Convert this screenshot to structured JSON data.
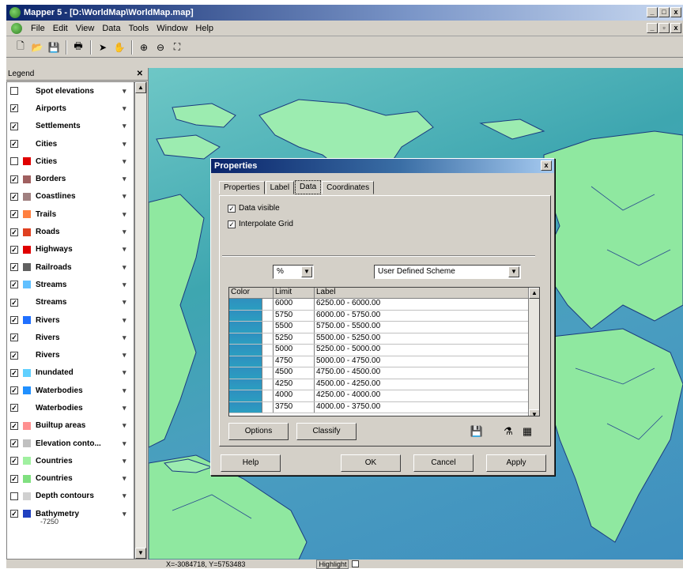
{
  "window": {
    "title": "Mapper 5 - [D:\\WorldMap\\WorldMap.map]"
  },
  "menu": [
    "File",
    "Edit",
    "View",
    "Data",
    "Tools",
    "Window",
    "Help"
  ],
  "legend": {
    "title": "Legend",
    "items": [
      {
        "label": "Spot elevations",
        "checked": false,
        "swatch": ""
      },
      {
        "label": "Airports",
        "checked": true,
        "swatch": ""
      },
      {
        "label": "Settlements",
        "checked": true,
        "swatch": ""
      },
      {
        "label": "Cities",
        "checked": true,
        "swatch": ""
      },
      {
        "label": "Cities",
        "checked": false,
        "swatch": "#e00000"
      },
      {
        "label": "Borders",
        "checked": true,
        "swatch": "#a06060"
      },
      {
        "label": "Coastlines",
        "checked": true,
        "swatch": "#a08080"
      },
      {
        "label": "Trails",
        "checked": true,
        "swatch": "#ff8040"
      },
      {
        "label": "Roads",
        "checked": true,
        "swatch": "#e04020"
      },
      {
        "label": "Highways",
        "checked": true,
        "swatch": "#e00000"
      },
      {
        "label": "Railroads",
        "checked": true,
        "swatch": "#606060"
      },
      {
        "label": "Streams",
        "checked": true,
        "swatch": "#60c0ff"
      },
      {
        "label": "Streams",
        "checked": true,
        "swatch": ""
      },
      {
        "label": "Rivers",
        "checked": true,
        "swatch": "#2070ff"
      },
      {
        "label": "Rivers",
        "checked": true,
        "swatch": ""
      },
      {
        "label": "Rivers",
        "checked": true,
        "swatch": ""
      },
      {
        "label": "Inundated",
        "checked": true,
        "swatch": "#60d0ff"
      },
      {
        "label": "Waterbodies",
        "checked": true,
        "swatch": "#2090ff"
      },
      {
        "label": "Waterbodies",
        "checked": true,
        "swatch": ""
      },
      {
        "label": "Builtup areas",
        "checked": true,
        "swatch": "#ff9090"
      },
      {
        "label": "Elevation conto...",
        "checked": true,
        "swatch": "#c0c0c0"
      },
      {
        "label": "Countries",
        "checked": true,
        "swatch": "#a0f0a0"
      },
      {
        "label": "Countries",
        "checked": true,
        "swatch": "#80e080"
      },
      {
        "label": "Depth contours",
        "checked": false,
        "swatch": "#d0d0d0"
      },
      {
        "label": "Bathymetry",
        "checked": true,
        "swatch": "#2040c0"
      }
    ],
    "bathymetry_sub": "-7250"
  },
  "status": {
    "coords": "X=-3084718, Y=5753483",
    "highlight": "Highlight"
  },
  "dialog": {
    "title": "Properties",
    "tabs": [
      "Properties",
      "Label",
      "Data",
      "Coordinates"
    ],
    "data_visible": "Data visible",
    "interpolate_grid": "Interpolate Grid",
    "unit_combo": "%",
    "scheme_combo": "User Defined Scheme",
    "grid_headers": [
      "Color",
      "Limit",
      "Label"
    ],
    "rows": [
      {
        "limit": "6000",
        "label": "6250.00 - 6000.00"
      },
      {
        "limit": "5750",
        "label": "6000.00 - 5750.00"
      },
      {
        "limit": "5500",
        "label": "5750.00 - 5500.00"
      },
      {
        "limit": "5250",
        "label": "5500.00 - 5250.00"
      },
      {
        "limit": "5000",
        "label": "5250.00 - 5000.00"
      },
      {
        "limit": "4750",
        "label": "5000.00 - 4750.00"
      },
      {
        "limit": "4500",
        "label": "4750.00 - 4500.00"
      },
      {
        "limit": "4250",
        "label": "4500.00 - 4250.00"
      },
      {
        "limit": "4000",
        "label": "4250.00 - 4000.00"
      },
      {
        "limit": "3750",
        "label": "4000.00 - 3750.00"
      }
    ],
    "btn_options": "Options",
    "btn_classify": "Classify",
    "btn_help": "Help",
    "btn_ok": "OK",
    "btn_cancel": "Cancel",
    "btn_apply": "Apply"
  },
  "colors": {
    "titlebar": "#0a246a",
    "map_water": "#3ea6b0",
    "land": "#8fe8a0"
  }
}
